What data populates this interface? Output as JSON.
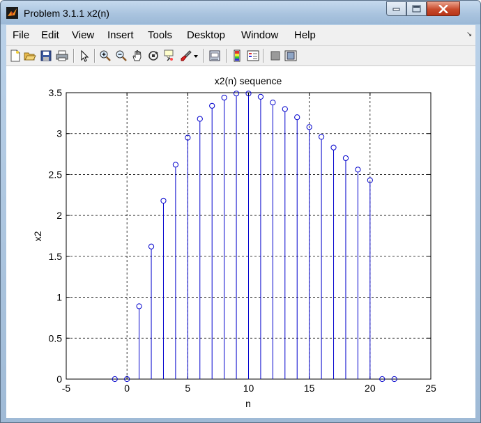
{
  "window": {
    "title": "Problem 3.1.1 x2(n)",
    "icons": [
      "matlab-figure-icon",
      "minimize-icon",
      "maximize-icon",
      "close-icon"
    ]
  },
  "menubar": {
    "items": [
      "File",
      "Edit",
      "View",
      "Insert",
      "Tools",
      "Desktop",
      "Window",
      "Help"
    ]
  },
  "toolbar": {
    "buttons": [
      "new-figure-icon",
      "open-file-icon",
      "save-icon",
      "print-icon",
      "edit-plot-arrow-icon",
      "zoom-in-icon",
      "zoom-out-icon",
      "pan-hand-icon",
      "rotate-3d-icon",
      "data-cursor-icon",
      "brush-icon",
      "brush-dropdown-icon",
      "link-plot-icon",
      "insert-colorbar-icon",
      "insert-legend-icon",
      "hide-plot-tools-icon",
      "show-plot-tools-icon"
    ]
  },
  "chart_data": {
    "type": "stem",
    "title": "x2(n) sequence",
    "xlabel": "n",
    "ylabel": "x2",
    "xlim": [
      -5,
      25
    ],
    "ylim": [
      0,
      3.5
    ],
    "x_ticks": [
      "-5",
      "0",
      "5",
      "10",
      "15",
      "20",
      "25"
    ],
    "y_ticks": [
      "0",
      "0.5",
      "1",
      "1.5",
      "2",
      "2.5",
      "3",
      "3.5"
    ],
    "x_tick_values": [
      -5,
      0,
      5,
      10,
      15,
      20,
      25
    ],
    "y_tick_values": [
      0,
      0.5,
      1,
      1.5,
      2,
      2.5,
      3,
      3.5
    ],
    "grid": true,
    "color": "#0000cc",
    "n": [
      -1,
      0,
      1,
      2,
      3,
      4,
      5,
      6,
      7,
      8,
      9,
      10,
      11,
      12,
      13,
      14,
      15,
      16,
      17,
      18,
      19,
      20,
      21,
      22
    ],
    "values": [
      0,
      0,
      0.89,
      1.62,
      2.18,
      2.62,
      2.95,
      3.18,
      3.34,
      3.44,
      3.49,
      3.49,
      3.45,
      3.38,
      3.3,
      3.2,
      3.08,
      2.96,
      2.83,
      2.7,
      2.56,
      2.43,
      0,
      0
    ]
  }
}
